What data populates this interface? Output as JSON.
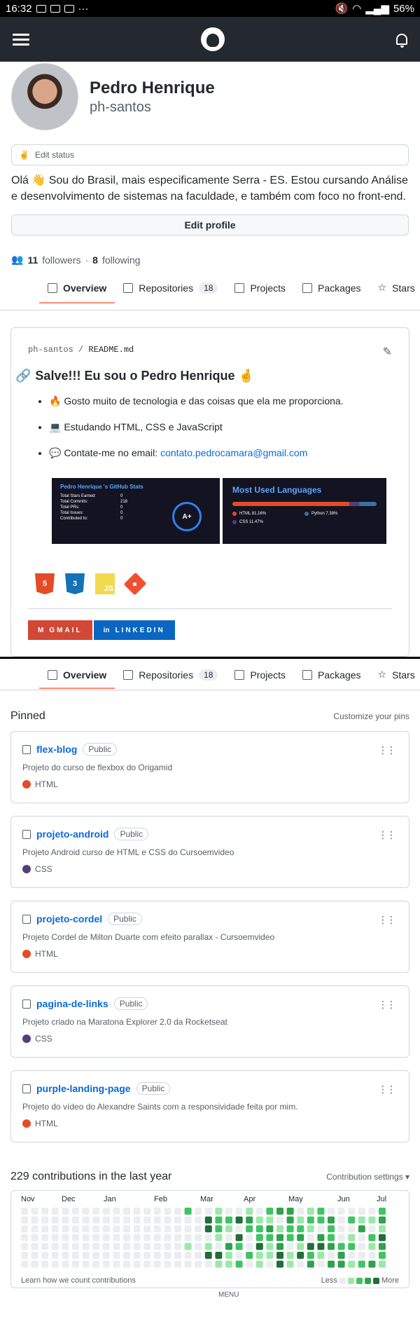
{
  "statusbar": {
    "time": "16:32",
    "battery": "56%"
  },
  "profile": {
    "name": "Pedro Henrique",
    "login": "ph-santos"
  },
  "status": {
    "label": "Edit status"
  },
  "bio": "Olá 👋 Sou do Brasil, mais especificamente Serra - ES. Estou cursando Análise e desenvolvimento de sistemas na faculdade, e também com foco no front-end.",
  "edit_profile": "Edit profile",
  "follow": {
    "followers_count": "11",
    "followers_label": "followers",
    "sep": "·",
    "following_count": "8",
    "following_label": "following"
  },
  "tabs": [
    {
      "label": "Overview"
    },
    {
      "label": "Repositories",
      "count": "18"
    },
    {
      "label": "Projects"
    },
    {
      "label": "Packages"
    },
    {
      "label": "Stars"
    }
  ],
  "readme": {
    "owner": "ph-santos",
    "slash": "/",
    "file": "README.md",
    "heading": "Salve!!! Eu sou o Pedro Henrique 🤞",
    "items": [
      "🔥 Gosto muito de tecnologia e das coisas que ela me proporciona.",
      "💻 Estudando HTML, CSS e JavaScript",
      "💬 Contate-me no email: "
    ],
    "email": "contato.pedrocamara@gmail.com",
    "stats_card": {
      "title": "Pedro Henrique 's GitHub Stats",
      "rows": [
        {
          "label": "Total Stars Earned:",
          "value": "0"
        },
        {
          "label": "Total Commits:",
          "value": "218"
        },
        {
          "label": "Total PRs:",
          "value": "0"
        },
        {
          "label": "Total Issues:",
          "value": "0"
        },
        {
          "label": "Contributed to:",
          "value": "0"
        }
      ],
      "grade": "A+"
    },
    "lang_card": {
      "title": "Most Used Languages",
      "langs": [
        {
          "label": "HTML 81.16%",
          "color": "#e34c26"
        },
        {
          "label": "Python 7.38%",
          "color": "#3572a5"
        },
        {
          "label": "CSS 11.47%",
          "color": "#563d7c"
        }
      ]
    },
    "tech_icons": [
      "html5-icon",
      "css3-icon",
      "javascript-icon",
      "git-icon"
    ],
    "tech_text": {
      "html": "5",
      "css": "3",
      "js": "JS",
      "git": "◆"
    },
    "badges": {
      "gmail": "GMAIL",
      "linkedin": "LINKEDIN"
    }
  },
  "pinned": {
    "title": "Pinned",
    "customize": "Customize your pins",
    "public_label": "Public",
    "repos": [
      {
        "name": "flex-blog",
        "desc": "Projeto do curso de flexbox do Origamid",
        "lang": "HTML",
        "color": "#e34c26"
      },
      {
        "name": "projeto-android",
        "desc": "Projeto Android curso de HTML e CSS do Cursoemvideo",
        "lang": "CSS",
        "color": "#563d7c"
      },
      {
        "name": "projeto-cordel",
        "desc": "Projeto Cordel de Milton Duarte com efeito parallax - Cursoemvideo",
        "lang": "HTML",
        "color": "#e34c26"
      },
      {
        "name": "pagina-de-links",
        "desc": "Projeto criado na Maratona Explorer 2.0 da Rocketseat",
        "lang": "CSS",
        "color": "#563d7c"
      },
      {
        "name": "purple-landing-page",
        "desc": "Projeto do vídeo do Alexandre Saints com a responsividade feita por mim.",
        "lang": "HTML",
        "color": "#e34c26"
      }
    ]
  },
  "contributions": {
    "title": "229 contributions in the last year",
    "settings": "Contribution settings ▾",
    "months": [
      "Nov",
      "Dec",
      "Jan",
      "Feb",
      "Mar",
      "Apr",
      "May",
      "Jun",
      "Jul"
    ],
    "learn": "Learn how we count contributions",
    "less": "Less",
    "more": "More",
    "colors": [
      "#ebedf0",
      "#9be9a8",
      "#40c463",
      "#30a14e",
      "#216e39"
    ],
    "cut_text": "MENU"
  }
}
